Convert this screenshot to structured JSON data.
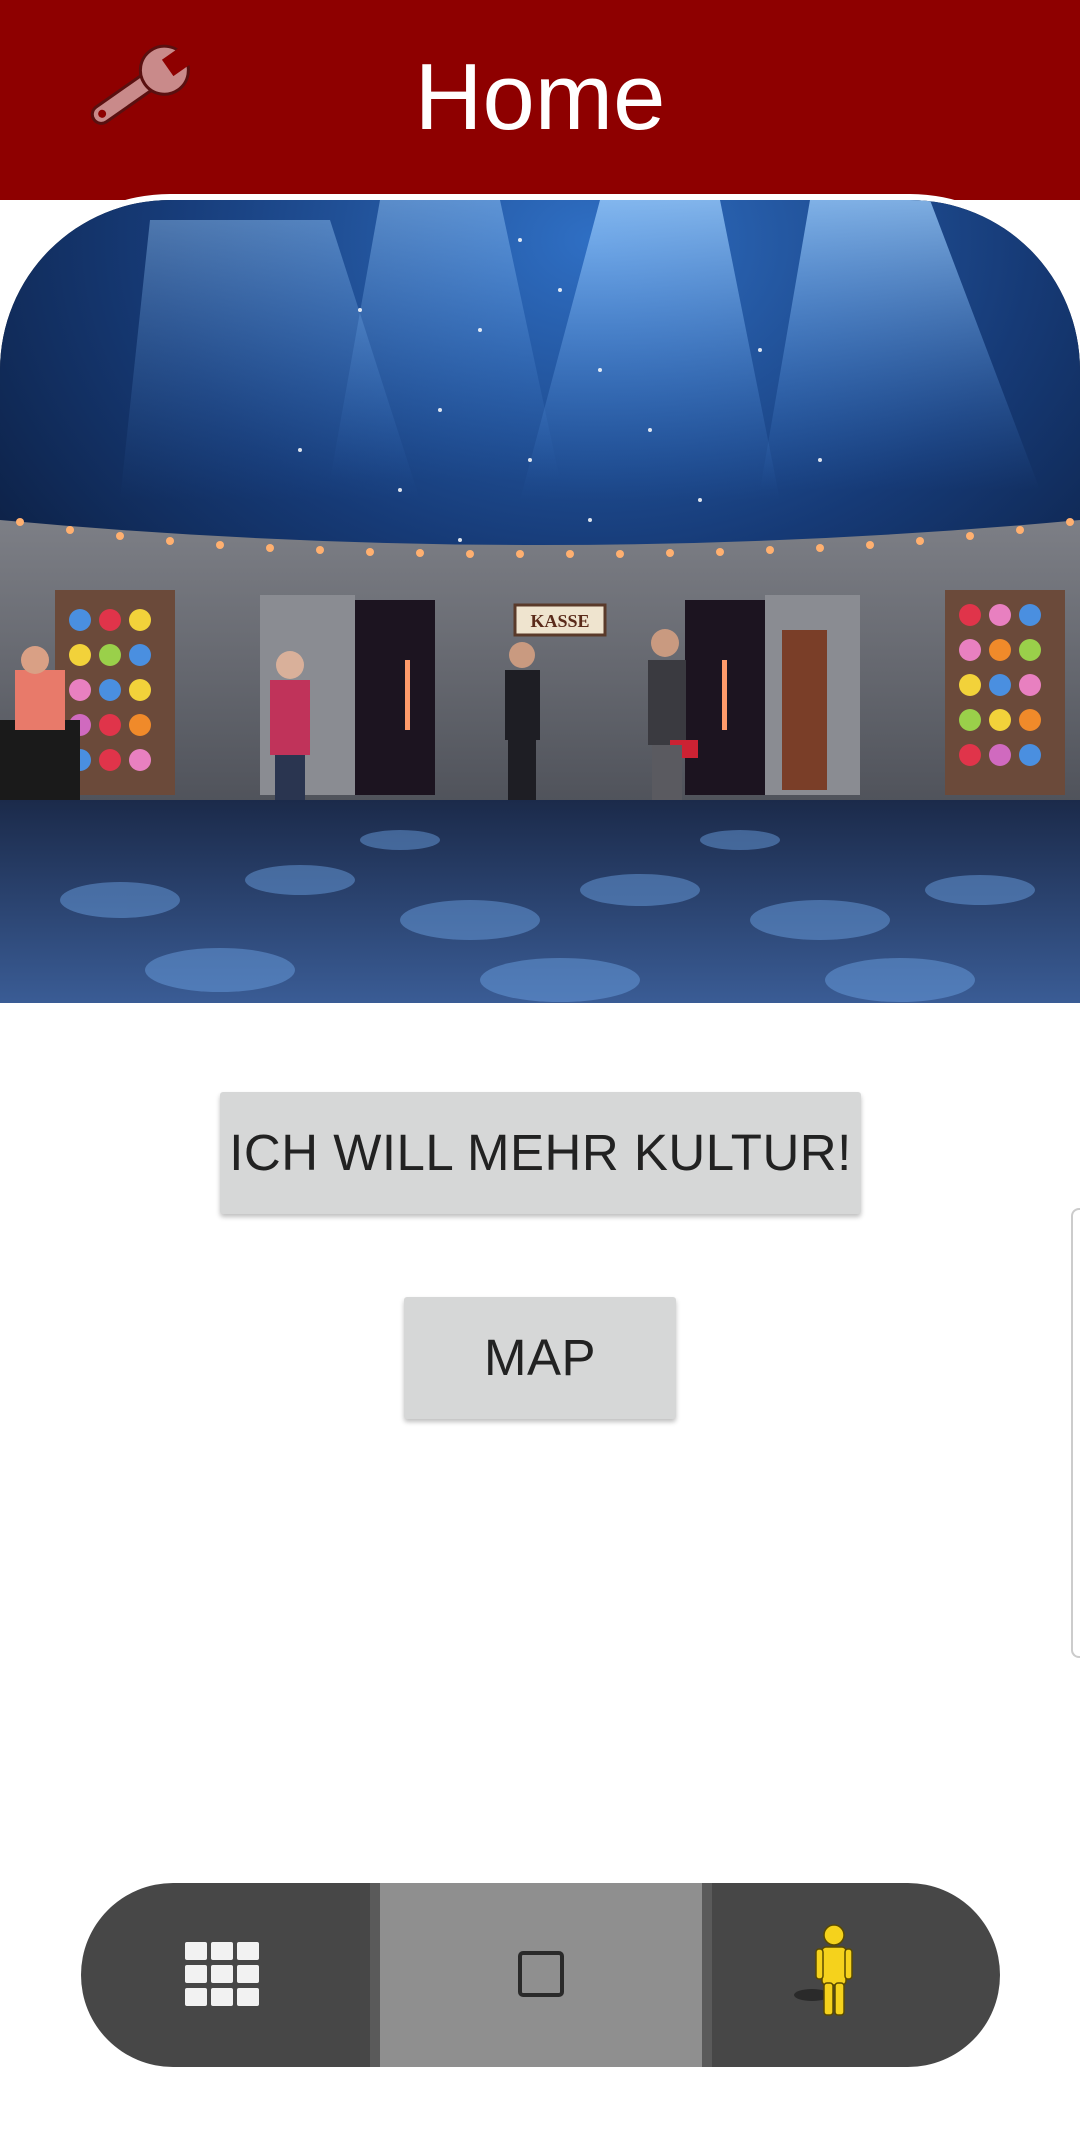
{
  "header": {
    "title": "Home",
    "settings_icon": "wrench-icon",
    "background_color": "#8e0000"
  },
  "hero": {
    "image": "theatre-stage-photo",
    "sign_text": "KASSE"
  },
  "buttons": {
    "culture_label": "ICH WILL MEHR KULTUR!",
    "map_label": "MAP"
  },
  "navbar": {
    "left_icon": "grid-icon",
    "center_icon": "square-icon",
    "right_icon": "person-icon"
  }
}
